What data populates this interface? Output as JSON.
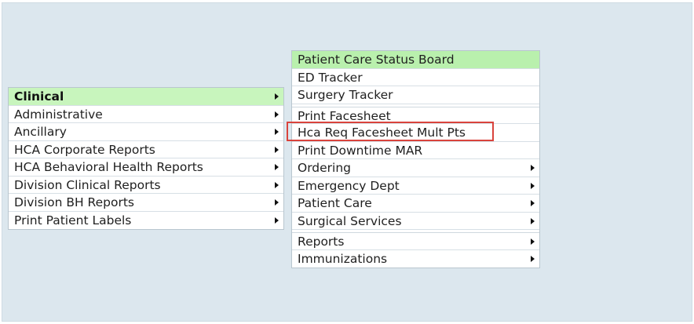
{
  "left_menu": {
    "items": [
      {
        "label": "Clinical",
        "has_submenu": true,
        "selected": true
      },
      {
        "label": "Administrative",
        "has_submenu": true
      },
      {
        "label": "Ancillary",
        "has_submenu": true
      },
      {
        "label": "HCA Corporate Reports",
        "has_submenu": true
      },
      {
        "label": "HCA Behavioral Health Reports",
        "has_submenu": true
      },
      {
        "label": "Division Clinical Reports",
        "has_submenu": true
      },
      {
        "label": "Division BH Reports",
        "has_submenu": true
      },
      {
        "label": "Print Patient Labels",
        "has_submenu": true
      }
    ]
  },
  "right_menu": {
    "items": [
      {
        "label": "Patient Care Status Board",
        "has_submenu": false,
        "highlighted": true
      },
      {
        "label": "ED Tracker",
        "has_submenu": false
      },
      {
        "label": "Surgery Tracker",
        "has_submenu": false
      },
      {
        "label": "Print Facesheet",
        "has_submenu": false
      },
      {
        "label": "Hca Req Facesheet Mult Pts",
        "has_submenu": false,
        "callout": true
      },
      {
        "label": "Print Downtime MAR",
        "has_submenu": false
      },
      {
        "label": "Ordering",
        "has_submenu": true
      },
      {
        "label": "Emergency Dept",
        "has_submenu": true
      },
      {
        "label": "Patient Care",
        "has_submenu": true
      },
      {
        "label": "Surgical Services",
        "has_submenu": true
      },
      {
        "label": "Reports",
        "has_submenu": true
      },
      {
        "label": "Immunizations",
        "has_submenu": true
      }
    ]
  },
  "colors": {
    "background": "#dce7ee",
    "selected_item": "#c8f5bd",
    "callout_border": "#d9433c"
  },
  "icons": {
    "submenu_arrow": "submenu-arrow-icon"
  }
}
